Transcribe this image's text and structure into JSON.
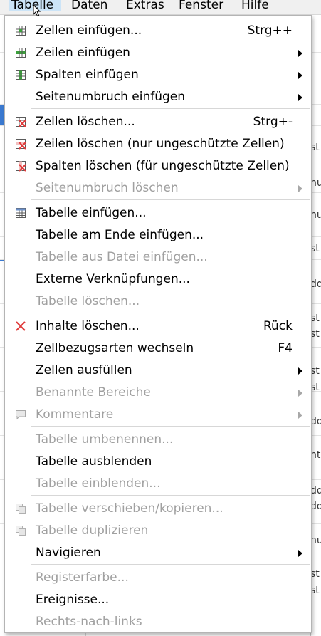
{
  "menubar": {
    "items": [
      {
        "label": "Tabelle"
      },
      {
        "label": "Daten"
      },
      {
        "label": "Extras"
      },
      {
        "label": "Fenster"
      },
      {
        "label": "Hilfe"
      }
    ]
  },
  "sheet_fragments": [
    "st",
    "nu",
    "nu",
    "st",
    "dd",
    "st",
    "st",
    "st",
    "st",
    "dd",
    "nt",
    "dd",
    "dd",
    "nu",
    "st",
    "st"
  ],
  "menu": {
    "items": [
      {
        "label": "Zellen einfügen...",
        "shortcut": "Strg++",
        "icon": "insert-cells-icon",
        "enabled": true,
        "submenu": false
      },
      {
        "label": "Zeilen einfügen",
        "icon": "insert-rows-icon",
        "enabled": true,
        "submenu": true
      },
      {
        "label": "Spalten einfügen",
        "icon": "insert-columns-icon",
        "enabled": true,
        "submenu": true
      },
      {
        "label": "Seitenumbruch einfügen",
        "enabled": true,
        "submenu": true
      },
      {
        "label": "Zellen löschen...",
        "shortcut": "Strg+-",
        "icon": "delete-cells-icon",
        "enabled": true,
        "submenu": false
      },
      {
        "label": "Zeilen löschen (nur ungeschützte Zellen)",
        "icon": "delete-rows-icon",
        "enabled": true,
        "submenu": false
      },
      {
        "label": "Spalten löschen (für ungeschützte Zellen)",
        "icon": "delete-columns-icon",
        "enabled": true,
        "submenu": false
      },
      {
        "label": "Seitenumbruch löschen",
        "enabled": false,
        "submenu": true
      },
      {
        "label": "Tabelle einfügen...",
        "icon": "insert-sheet-icon",
        "enabled": true,
        "submenu": false
      },
      {
        "label": "Tabelle am Ende einfügen...",
        "enabled": true,
        "submenu": false
      },
      {
        "label": "Tabelle aus Datei einfügen...",
        "enabled": false,
        "submenu": false
      },
      {
        "label": "Externe Verknüpfungen...",
        "enabled": true,
        "submenu": false
      },
      {
        "label": "Tabelle löschen...",
        "enabled": false,
        "submenu": false
      },
      {
        "label": "Inhalte löschen...",
        "shortcut": "Rück",
        "icon": "clear-contents-icon",
        "enabled": true,
        "submenu": false
      },
      {
        "label": "Zellbezugsarten wechseln",
        "shortcut": "F4",
        "enabled": true,
        "submenu": false
      },
      {
        "label": "Zellen ausfüllen",
        "enabled": true,
        "submenu": true
      },
      {
        "label": "Benannte Bereiche",
        "enabled": false,
        "submenu": true
      },
      {
        "label": "Kommentare",
        "icon": "comment-icon",
        "enabled": false,
        "submenu": true
      },
      {
        "label": "Tabelle umbenennen...",
        "enabled": false,
        "submenu": false
      },
      {
        "label": "Tabelle ausblenden",
        "enabled": true,
        "submenu": false
      },
      {
        "label": "Tabelle einblenden...",
        "enabled": false,
        "submenu": false
      },
      {
        "label": "Tabelle verschieben/kopieren...",
        "icon": "move-copy-sheet-icon",
        "enabled": false,
        "submenu": false
      },
      {
        "label": "Tabelle duplizieren",
        "icon": "duplicate-sheet-icon",
        "enabled": false,
        "submenu": false
      },
      {
        "label": "Navigieren",
        "enabled": true,
        "submenu": true
      },
      {
        "label": "Registerfarbe...",
        "enabled": false,
        "submenu": false
      },
      {
        "label": "Ereignisse...",
        "enabled": true,
        "submenu": false
      },
      {
        "label": "Rechts-nach-links",
        "enabled": false,
        "submenu": false
      }
    ]
  },
  "colors": {
    "menubar_active": "#cce4f7",
    "disabled_text": "#a0a0a0",
    "delete_red": "#e03c3c",
    "insert_green": "#3ca03c"
  }
}
